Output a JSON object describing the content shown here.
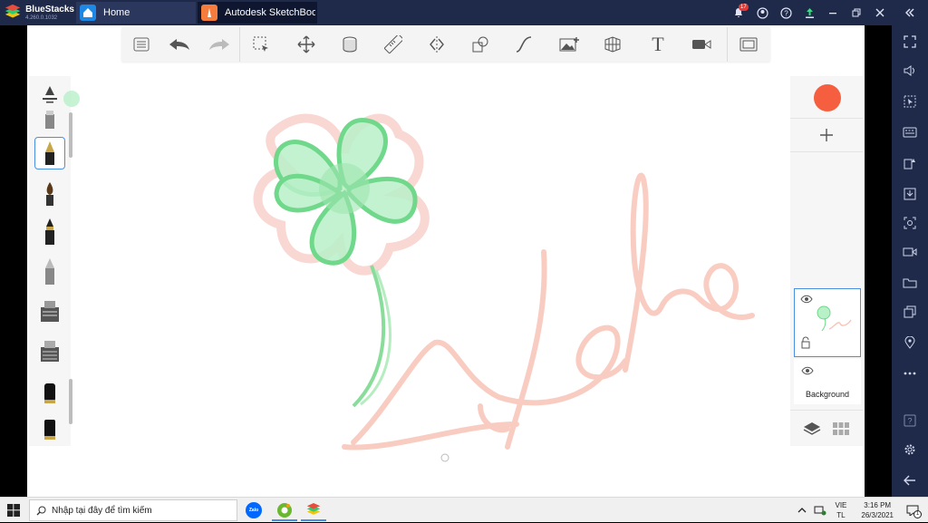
{
  "bluestacks": {
    "name": "BlueStacks",
    "version": "4.260.0.1032"
  },
  "tabs": [
    {
      "label": "Home"
    },
    {
      "label": "Autodesk SketchBook"
    }
  ],
  "titlebar": {
    "notification_count": "17"
  },
  "layers": {
    "background_label": "Background"
  },
  "taskbar": {
    "search_placeholder": "Nhập tại đây để tìm kiếm",
    "lang_top": "VIE",
    "lang_bottom": "TL",
    "time": "3:16 PM",
    "date": "26/3/2021",
    "notif_count": "1",
    "zalo_label": "Zalo"
  },
  "colors": {
    "current_color": "#f55f3f",
    "accent": "#4a90e2"
  },
  "toolbar": {
    "text_tool_glyph": "T"
  }
}
